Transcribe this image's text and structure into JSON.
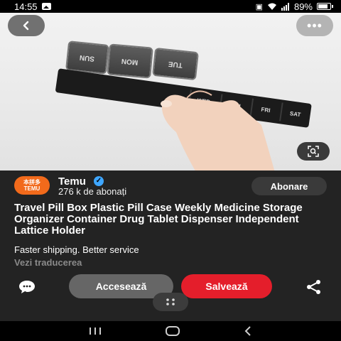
{
  "status_bar": {
    "time": "14:55",
    "battery": "89%",
    "battery_level": 0.89
  },
  "media": {
    "lids": [
      "SUN",
      "MON",
      "TUE"
    ],
    "compartments": [
      "WED",
      "THU",
      "FRI",
      "SAT"
    ]
  },
  "channel": {
    "logo_line1": "本拼多",
    "logo_line2": "TEMU",
    "name": "Temu",
    "subscribers": "276 k de abonați",
    "subscribe_label": "Abonare"
  },
  "post": {
    "title": "Travel Pill Box Plastic Pill Case Weekly Medicine Storage Organizer Container Drug Tablet Dispenser Independent Lattice Holder",
    "subtitle": "Faster shipping. Better service",
    "translate_label": "Vezi traducerea"
  },
  "actions": {
    "access_label": "Accesează",
    "save_label": "Salvează"
  },
  "colors": {
    "save": "#e41e2b",
    "temu_orange": "#f26a1b",
    "verified": "#3ea6ff"
  }
}
